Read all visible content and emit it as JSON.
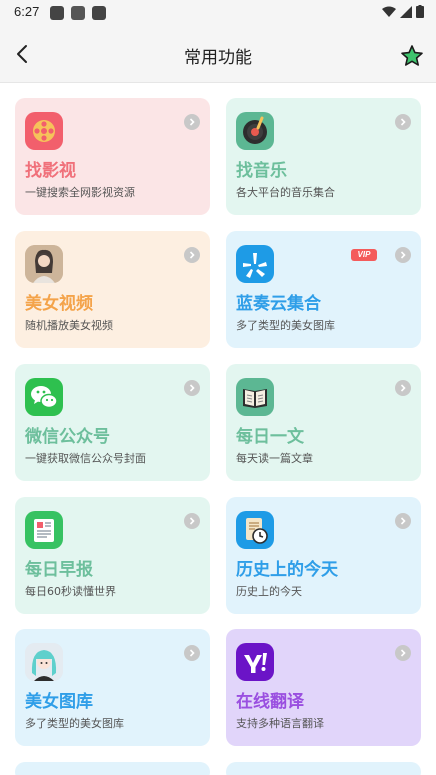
{
  "status_bar": {
    "time": "6:27"
  },
  "header": {
    "title": "常用功能"
  },
  "colors": {
    "pink_bg": "#fbe5e6",
    "mint_bg": "#e3f6f0",
    "peach_bg": "#fdefe1",
    "blue_bg": "#e1f3fc",
    "purple_bg": "#e1d5fa"
  },
  "cards": [
    {
      "title": "找影视",
      "subtitle": "一键搜索全网影视资源",
      "icon": "film-reel-icon",
      "title_color": "#f0707a"
    },
    {
      "title": "找音乐",
      "subtitle": "各大平台的音乐集合",
      "icon": "vinyl-record-icon",
      "title_color": "#6dbf9c"
    },
    {
      "title": "美女视频",
      "subtitle": "随机播放美女视频",
      "icon": "portrait-photo-icon",
      "title_color": "#f4a34a"
    },
    {
      "title": "蓝奏云集合",
      "subtitle": "多了类型的美女图库",
      "icon": "yelp-icon",
      "title_color": "#2f9ee8",
      "badge": "VIP"
    },
    {
      "title": "微信公众号",
      "subtitle": "一键获取微信公众号封面",
      "icon": "wechat-icon",
      "title_color": "#6dbf9c"
    },
    {
      "title": "每日一文",
      "subtitle": "每天读一篇文章",
      "icon": "open-book-icon",
      "title_color": "#6dbf9c"
    },
    {
      "title": "每日早报",
      "subtitle": "每日60秒读懂世界",
      "icon": "newspaper-icon",
      "title_color": "#6dbf9c"
    },
    {
      "title": "历史上的今天",
      "subtitle": "历史上的今天",
      "icon": "history-clock-icon",
      "title_color": "#2f9ee8"
    },
    {
      "title": "美女图库",
      "subtitle": "多了类型的美女图库",
      "icon": "anime-avatar-icon",
      "title_color": "#2f9ee8"
    },
    {
      "title": "在线翻译",
      "subtitle": "支持多种语言翻译",
      "icon": "yahoo-icon",
      "title_color": "#9a4fe0"
    }
  ]
}
